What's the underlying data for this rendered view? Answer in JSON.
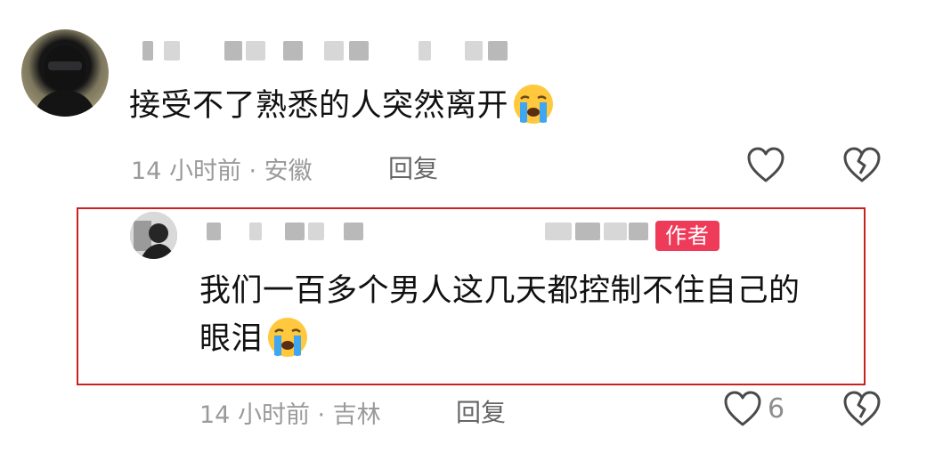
{
  "comments": [
    {
      "text": "接受不了熟悉的人突然离开",
      "meta": "14 小时前 · 安徽",
      "reply_label": "回复"
    },
    {
      "author_badge": "作者",
      "text_line1": "我们一百多个男人这几天都控制不住自己的",
      "text_line2": "眼泪",
      "meta": "14 小时前 · 吉林",
      "reply_label": "回复",
      "like_count": "6"
    }
  ],
  "icons": {
    "emoji": "loudly-crying-face-emoji",
    "like": "heart-outline-icon",
    "dislike": "broken-heart-icon"
  },
  "colors": {
    "author_badge": "#ef3b5a",
    "highlight_frame": "#c9211e"
  }
}
